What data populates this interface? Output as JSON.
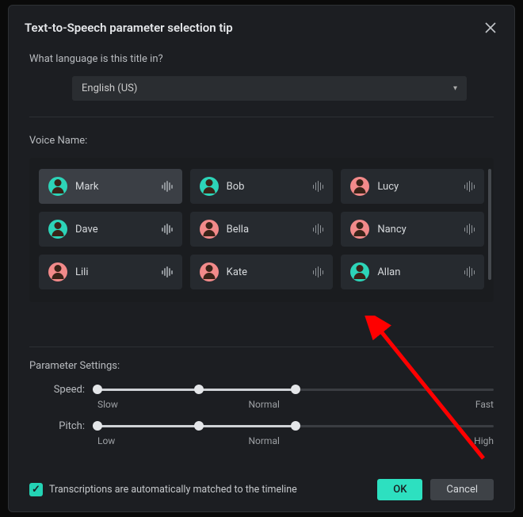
{
  "dialog": {
    "title": "Text-to-Speech parameter selection tip",
    "question": "What language is this title in?",
    "language_selected": "English (US)"
  },
  "voice": {
    "label": "Voice Name:",
    "options": [
      {
        "name": "Mark",
        "color": "teal",
        "selected": true
      },
      {
        "name": "Bob",
        "color": "teal",
        "selected": false
      },
      {
        "name": "Lucy",
        "color": "pink",
        "selected": false
      },
      {
        "name": "Dave",
        "color": "teal",
        "selected": false
      },
      {
        "name": "Bella",
        "color": "pink",
        "selected": false
      },
      {
        "name": "Nancy",
        "color": "pink",
        "selected": false
      },
      {
        "name": "Lili",
        "color": "pink",
        "selected": false
      },
      {
        "name": "Kate",
        "color": "pink",
        "selected": false
      },
      {
        "name": "Allan",
        "color": "teal",
        "selected": false
      }
    ]
  },
  "params": {
    "label": "Parameter Settings:",
    "speed": {
      "name": "Speed:",
      "ticks": [
        "Slow",
        "Normal",
        "Fast"
      ],
      "value": 0.5
    },
    "pitch": {
      "name": "Pitch:",
      "ticks": [
        "Low",
        "Normal",
        "High"
      ],
      "value": 0.5
    }
  },
  "checkbox": {
    "label": "Transcriptions are automatically matched to the timeline",
    "checked": true
  },
  "buttons": {
    "ok": "OK",
    "cancel": "Cancel"
  }
}
